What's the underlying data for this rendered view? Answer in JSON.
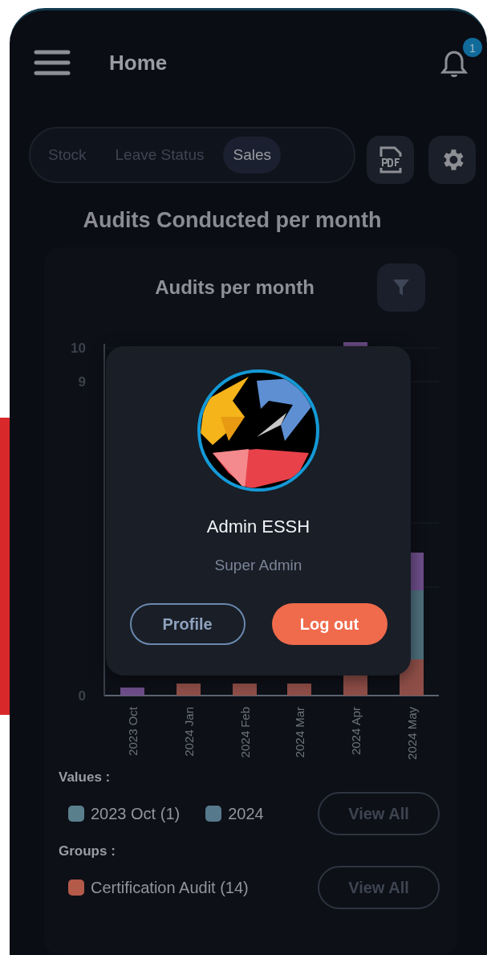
{
  "top_bar": {
    "title": "Home",
    "notification_count": "1"
  },
  "tabs": [
    {
      "label": "Stock",
      "selected": false
    },
    {
      "label": "Leave Status",
      "selected": false
    },
    {
      "label": "Sales",
      "selected": true
    }
  ],
  "page_title": "Audits Conducted per month",
  "chart": {
    "title": "Audits per month",
    "y_tick_labels": [
      "10",
      "9",
      "0"
    ],
    "x_labels": [
      "2023 Oct",
      "2024 Jan",
      "2024 Feb",
      "2024 Mar",
      "2024 Apr",
      "2024 May"
    ]
  },
  "legend": {
    "values_label": "Values :",
    "values": [
      {
        "label": "2023 Oct (1)",
        "color": "#5a7f8c"
      },
      {
        "label": "2024",
        "color": "#56798b"
      }
    ],
    "values_button": "View All",
    "groups_label": "Groups :",
    "groups": [
      {
        "label": "Certification Audit (14)",
        "color": "#b35a4a"
      }
    ],
    "groups_button": "View All"
  },
  "profile_popup": {
    "name": "Admin ESSH",
    "role": "Super Admin",
    "buttons": [
      {
        "label": "Profile",
        "kind": "outline"
      },
      {
        "label": "Log out",
        "kind": "primary"
      }
    ]
  }
}
